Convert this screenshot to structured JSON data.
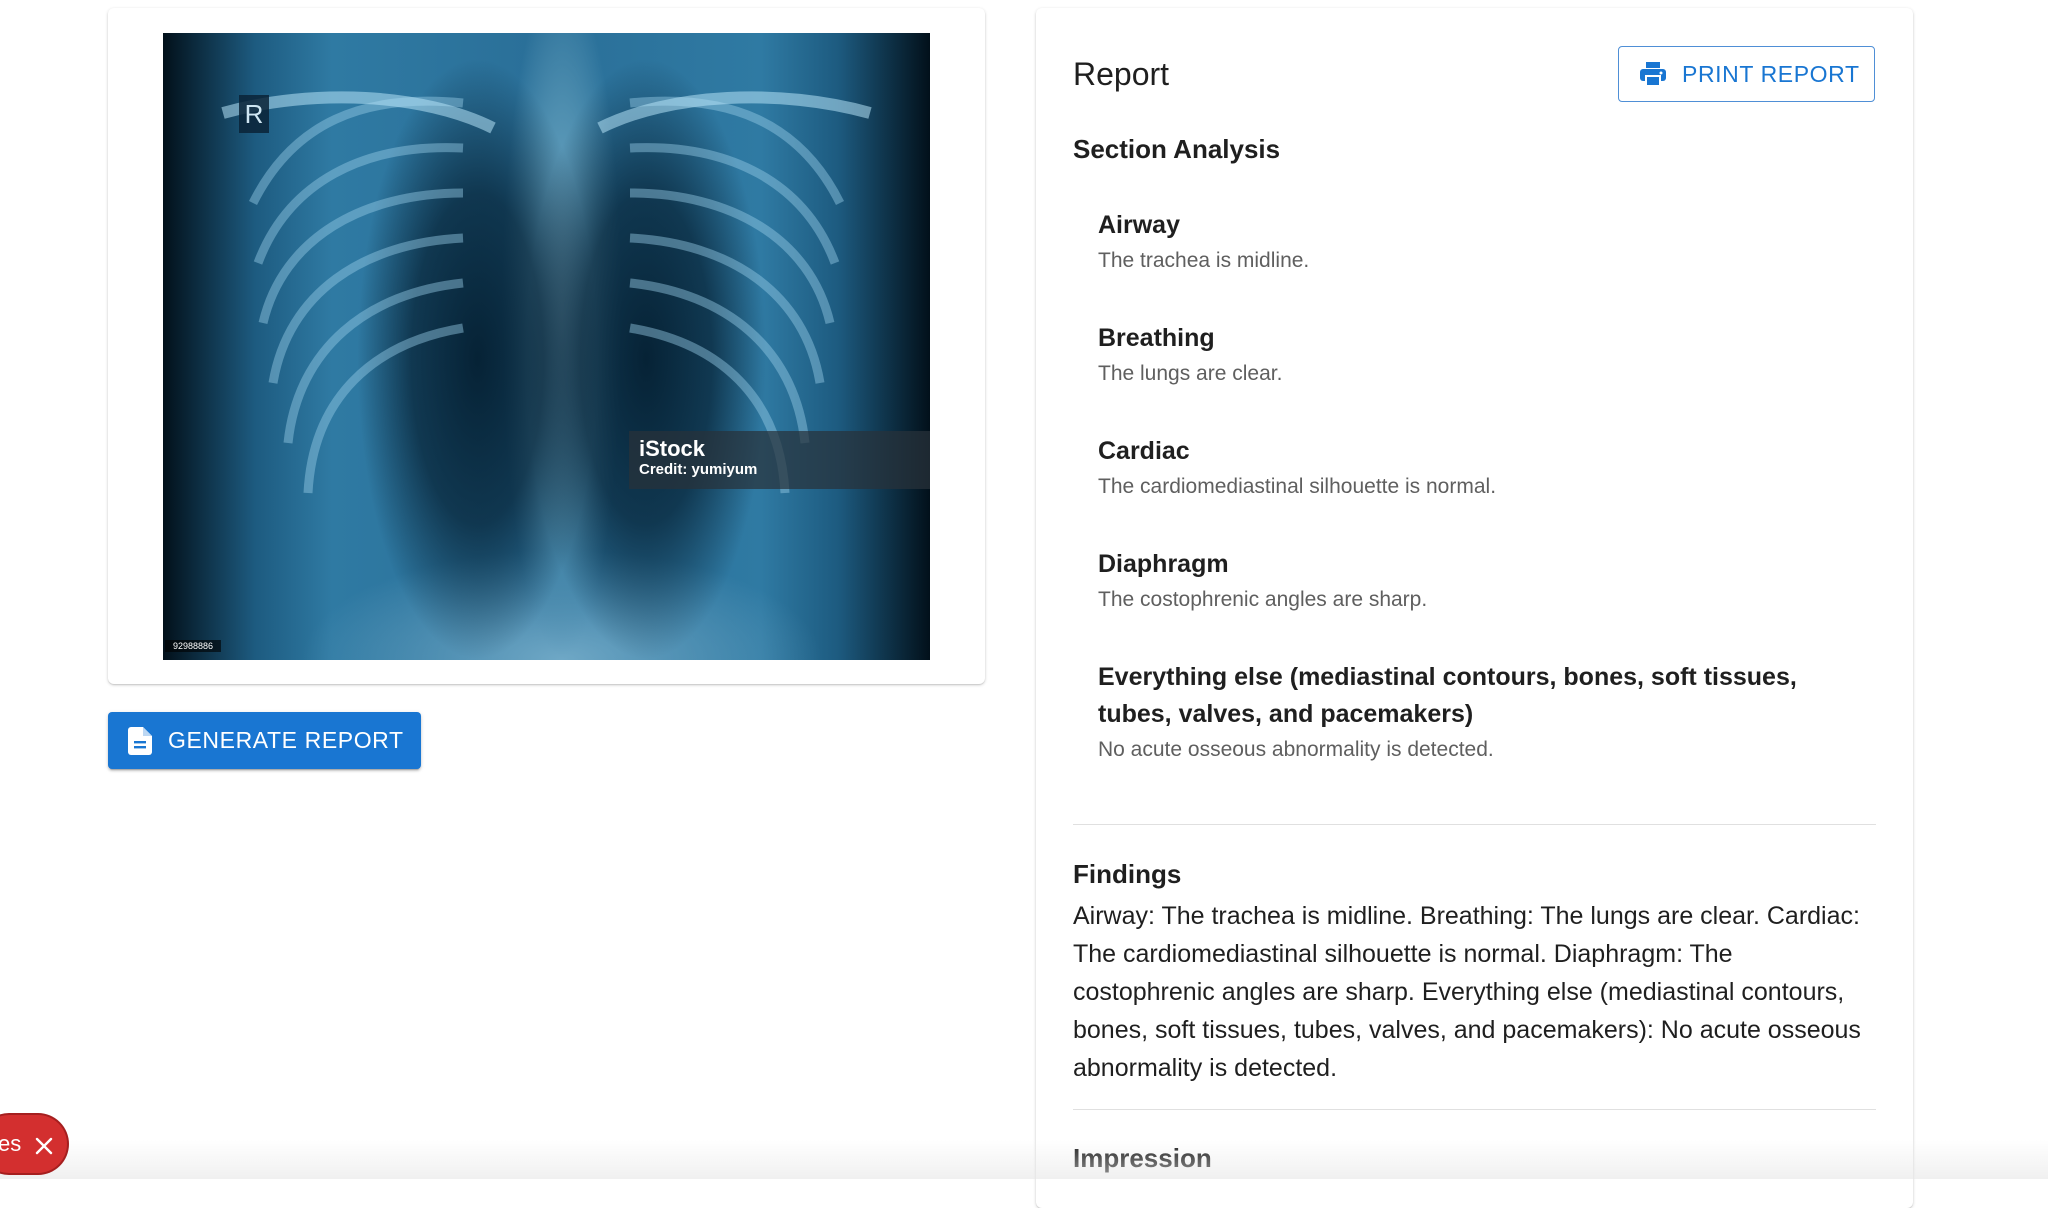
{
  "xray_card": {
    "marker": "R",
    "watermark_logo": "iStock",
    "watermark_credit": "Credit: yumiyum",
    "image_id": "92988886"
  },
  "actions": {
    "generate_label": "GENERATE REPORT"
  },
  "report": {
    "title": "Report",
    "print_label": "PRINT REPORT",
    "section_analysis_heading": "Section Analysis",
    "sections": [
      {
        "title": "Airway",
        "text": "The trachea is midline."
      },
      {
        "title": "Breathing",
        "text": "The lungs are clear."
      },
      {
        "title": "Cardiac",
        "text": "The cardiomediastinal silhouette is normal."
      },
      {
        "title": "Diaphragm",
        "text": "The costophrenic angles are sharp."
      },
      {
        "title": "Everything else (mediastinal contours, bones, soft tissues, tubes, valves, and pacemakers)",
        "text": "No acute osseous abnormality is detected."
      }
    ],
    "findings_heading": "Findings",
    "findings_text": "Airway: The trachea is midline. Breathing: The lungs are clear. Cardiac: The cardiomediastinal silhouette is normal. Diaphragm: The costophrenic angles are sharp. Everything else (mediastinal contours, bones, soft tissues, tubes, valves, and pacemakers): No acute osseous abnormality is detected.",
    "impression_heading": "Impression"
  },
  "issues_chip": {
    "label": "es"
  },
  "colors": {
    "primary": "#1976d2",
    "error": "#d32f2f"
  }
}
